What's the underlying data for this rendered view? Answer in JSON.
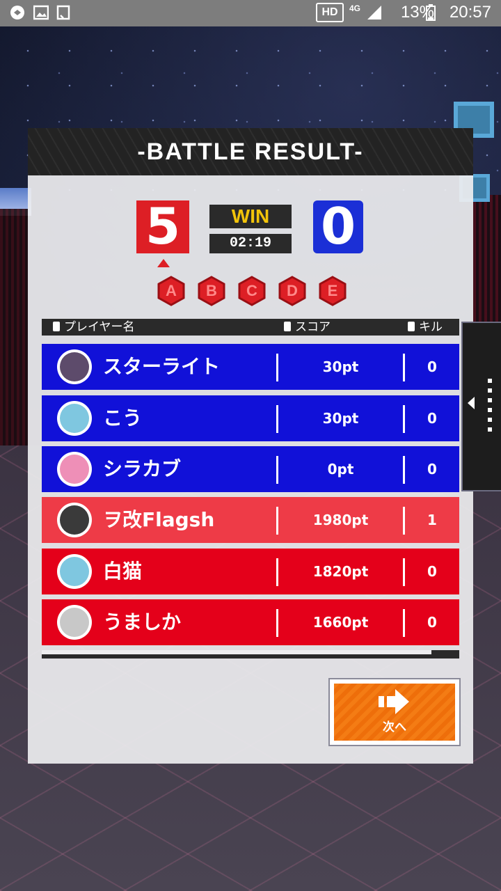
{
  "statusbar": {
    "hd_label": "HD",
    "network": "4G",
    "battery": "13%",
    "time": "20:57",
    "icons": [
      "settings-icon",
      "gallery-icon",
      "clipboard-icon",
      "signal-icon",
      "battery-icon"
    ]
  },
  "panel": {
    "title": "-BATTLE RESULT-",
    "red_score": "5",
    "blue_score": "0",
    "result": "WIN",
    "time": "02:19",
    "points": [
      "A",
      "B",
      "C",
      "D",
      "E"
    ]
  },
  "table": {
    "col_player": "プレイヤー名",
    "col_score": "スコア",
    "col_kill": "キル",
    "rows": [
      {
        "team": "blue",
        "name": "スターライト",
        "score": "30pt",
        "kill": "0",
        "avatar_color": "#5d4b6b"
      },
      {
        "team": "blue",
        "name": "こう",
        "score": "30pt",
        "kill": "0",
        "avatar_color": "#7fc7e0"
      },
      {
        "team": "blue",
        "name": "シラカブ",
        "score": "0pt",
        "kill": "0",
        "avatar_color": "#ee8fb7"
      },
      {
        "team": "red",
        "name": "ヲ改Flagsh",
        "score": "1980pt",
        "kill": "1",
        "avatar_color": "#3a3a3a"
      },
      {
        "team": "red",
        "name": "白猫",
        "score": "1820pt",
        "kill": "0",
        "avatar_color": "#7fc7e0"
      },
      {
        "team": "red",
        "name": "うましか",
        "score": "1660pt",
        "kill": "0",
        "avatar_color": "#c8c8c8"
      }
    ]
  },
  "next_button": {
    "label": "次へ",
    "icon": "arrow-right-icon"
  },
  "colors": {
    "red": "#e4001a",
    "blue": "#1111d8",
    "gold": "#f2c40a",
    "orange": "#f47c14"
  }
}
